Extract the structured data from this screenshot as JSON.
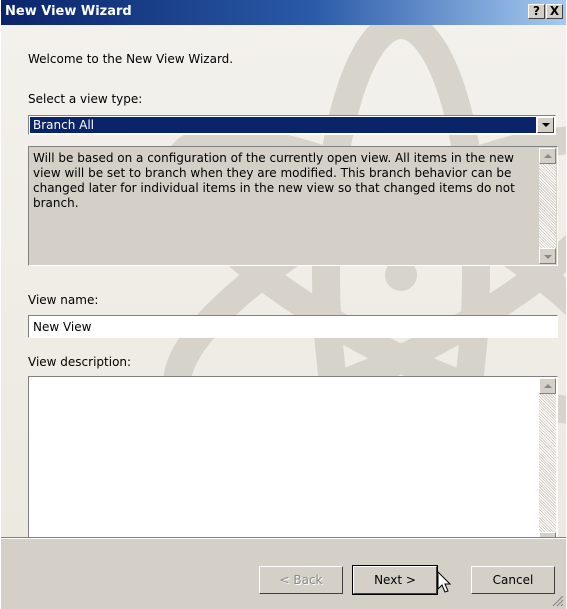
{
  "window": {
    "title": "New View Wizard",
    "help_label": "?",
    "close_label": "X"
  },
  "wizard": {
    "welcome_text": "Welcome to the New View Wizard.",
    "view_type_label": "Select a view type:",
    "view_type_selected": "Branch All",
    "view_type_description": "Will be based on a configuration of the currently open view. All items in the new view will be set to branch when they are modified. This branch behavior can be changed later for individual items in the new view so that changed items do not branch.",
    "view_name_label": "View name:",
    "view_name_value": "New View",
    "view_description_label": "View description:",
    "view_description_value": ""
  },
  "footer": {
    "back_label": "< Back",
    "next_label": "Next >",
    "cancel_label": "Cancel"
  },
  "icons": {
    "dropdown": "chevron-down-icon",
    "scroll_up": "scroll-up-icon",
    "scroll_down": "scroll-down-icon",
    "cursor": "mouse-pointer-icon",
    "help": "help-icon",
    "close": "close-icon"
  },
  "colors": {
    "title_bar": "#0a246a",
    "selection": "#0a246a",
    "dialog_face": "#d4d0c8"
  }
}
